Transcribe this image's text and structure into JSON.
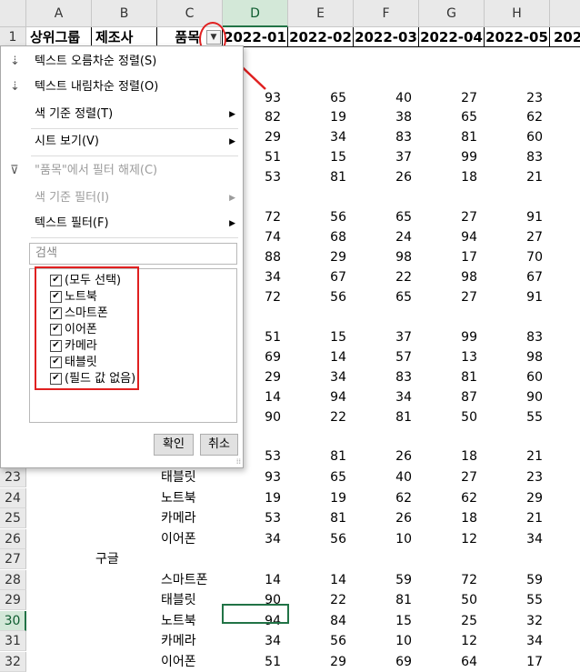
{
  "columns": [
    "A",
    "B",
    "C",
    "D",
    "E",
    "F",
    "G",
    "H"
  ],
  "header_row": {
    "row_number": "1",
    "a": "상위그룹",
    "b": "제조사",
    "c": "품목",
    "d": "2022-01",
    "e": "2022-02",
    "f": "2022-03",
    "g": "2022-04",
    "h": "2022-05",
    "i": "202"
  },
  "under_menu_values": [
    [
      "93",
      "65",
      "40",
      "27",
      "23"
    ],
    [
      "82",
      "19",
      "38",
      "65",
      "62"
    ],
    [
      "29",
      "34",
      "83",
      "81",
      "60"
    ],
    [
      "51",
      "15",
      "37",
      "99",
      "83"
    ],
    [
      "53",
      "81",
      "26",
      "18",
      "21"
    ],
    [
      "72",
      "56",
      "65",
      "27",
      "91"
    ],
    [
      "74",
      "68",
      "24",
      "94",
      "27"
    ],
    [
      "88",
      "29",
      "98",
      "17",
      "70"
    ],
    [
      "34",
      "67",
      "22",
      "98",
      "67"
    ],
    [
      "72",
      "56",
      "65",
      "27",
      "91"
    ],
    [
      "51",
      "15",
      "37",
      "99",
      "83"
    ],
    [
      "69",
      "14",
      "57",
      "13",
      "98"
    ],
    [
      "29",
      "34",
      "83",
      "81",
      "60"
    ],
    [
      "14",
      "94",
      "34",
      "87",
      "90"
    ],
    [
      "90",
      "22",
      "81",
      "50",
      "55"
    ],
    [
      "53",
      "81",
      "26",
      "18",
      "21"
    ]
  ],
  "rows": [
    {
      "n": "23",
      "b": "",
      "c": "태블릿",
      "v": [
        "93",
        "65",
        "40",
        "27",
        "23"
      ]
    },
    {
      "n": "24",
      "b": "",
      "c": "노트북",
      "v": [
        "19",
        "19",
        "62",
        "62",
        "29"
      ]
    },
    {
      "n": "25",
      "b": "",
      "c": "카메라",
      "v": [
        "53",
        "81",
        "26",
        "18",
        "21"
      ]
    },
    {
      "n": "26",
      "b": "",
      "c": "이어폰",
      "v": [
        "34",
        "56",
        "10",
        "12",
        "34"
      ]
    },
    {
      "n": "27",
      "b": "구글",
      "c": "",
      "v": [
        "",
        "",
        "",
        "",
        ""
      ]
    },
    {
      "n": "28",
      "b": "",
      "c": "스마트폰",
      "v": [
        "14",
        "14",
        "59",
        "72",
        "59"
      ]
    },
    {
      "n": "29",
      "b": "",
      "c": "태블릿",
      "v": [
        "90",
        "22",
        "81",
        "50",
        "55"
      ]
    },
    {
      "n": "30",
      "b": "",
      "c": "노트북",
      "v": [
        "94",
        "84",
        "15",
        "25",
        "32"
      ]
    },
    {
      "n": "31",
      "b": "",
      "c": "카메라",
      "v": [
        "34",
        "56",
        "10",
        "12",
        "34"
      ]
    },
    {
      "n": "32",
      "b": "",
      "c": "이어폰",
      "v": [
        "51",
        "29",
        "69",
        "64",
        "17"
      ]
    }
  ],
  "menu": {
    "sort_asc": "텍스트 오름차순 정렬(S)",
    "sort_desc": "텍스트 내림차순 정렬(O)",
    "sort_color": "색 기준 정렬(T)",
    "sheet_view": "시트 보기(V)",
    "clear_filter": "\"품목\"에서 필터 해제(C)",
    "color_filter": "색 기준 필터(I)",
    "text_filter": "텍스트 필터(F)",
    "search_placeholder": "검색",
    "items": [
      "(모두 선택)",
      "노트북",
      "스마트폰",
      "이어폰",
      "카메라",
      "태블릿",
      "(필드 값 없음)"
    ],
    "ok": "확인",
    "cancel": "취소"
  },
  "colors": {
    "selection": "#217346",
    "annotation": "#e02020"
  }
}
